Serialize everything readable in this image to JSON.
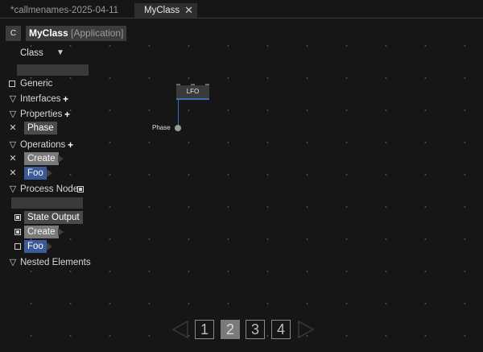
{
  "tabs": [
    {
      "label": "*callmenames-2025-04-11",
      "active": false
    },
    {
      "label": "MyClass",
      "active": true,
      "close_glyph": "✕"
    }
  ],
  "header": {
    "badge": "C",
    "class_name": "MyClass",
    "class_kind": "[Application]"
  },
  "class_selector": {
    "label": "Class",
    "arrow": "▼"
  },
  "sections": {
    "generic": {
      "label": "Generic"
    },
    "interfaces": {
      "label": "Interfaces",
      "mark": "▽",
      "add": "+"
    },
    "properties": {
      "label": "Properties",
      "mark": "▽",
      "add": "+",
      "items": [
        {
          "remove": "✕",
          "name": "Phase"
        }
      ]
    },
    "operations": {
      "label": "Operations",
      "mark": "▽",
      "add": "+",
      "items": [
        {
          "remove": "✕",
          "name": "Create"
        },
        {
          "remove": "✕",
          "name": "Foo"
        }
      ]
    },
    "process_node": {
      "label": "Process Node",
      "mark": "▽",
      "items": [
        {
          "name": "State Output"
        },
        {
          "name": "Create"
        },
        {
          "name": "Foo"
        }
      ]
    },
    "nested": {
      "label": "Nested Elements",
      "mark": "▽"
    }
  },
  "graph": {
    "node_label": "LFO",
    "port_label": "Phase"
  },
  "pager": {
    "pages": [
      "1",
      "2",
      "3",
      "4"
    ],
    "current": "2"
  },
  "colors": {
    "background": "#161616",
    "accent_blue": "#3d6cc0",
    "pill_blue": "#3a5a9a",
    "pill_gray": "#4a4a4a"
  }
}
